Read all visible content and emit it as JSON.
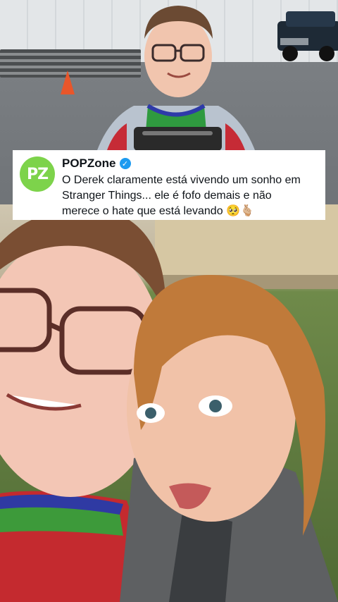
{
  "post": {
    "author": "POPZone",
    "avatar_text": "PZ",
    "verified": true,
    "text": "O Derek claramente está vivendo um sonho em\nStranger Things... ele é fofo demais e não\nmerece o hate que está levando 🥺🫰🏼"
  },
  "colors": {
    "avatar_bg": "#7dd34b",
    "verified_badge": "#1d9bf0"
  },
  "icons": {
    "verified": "check-badge-icon"
  }
}
